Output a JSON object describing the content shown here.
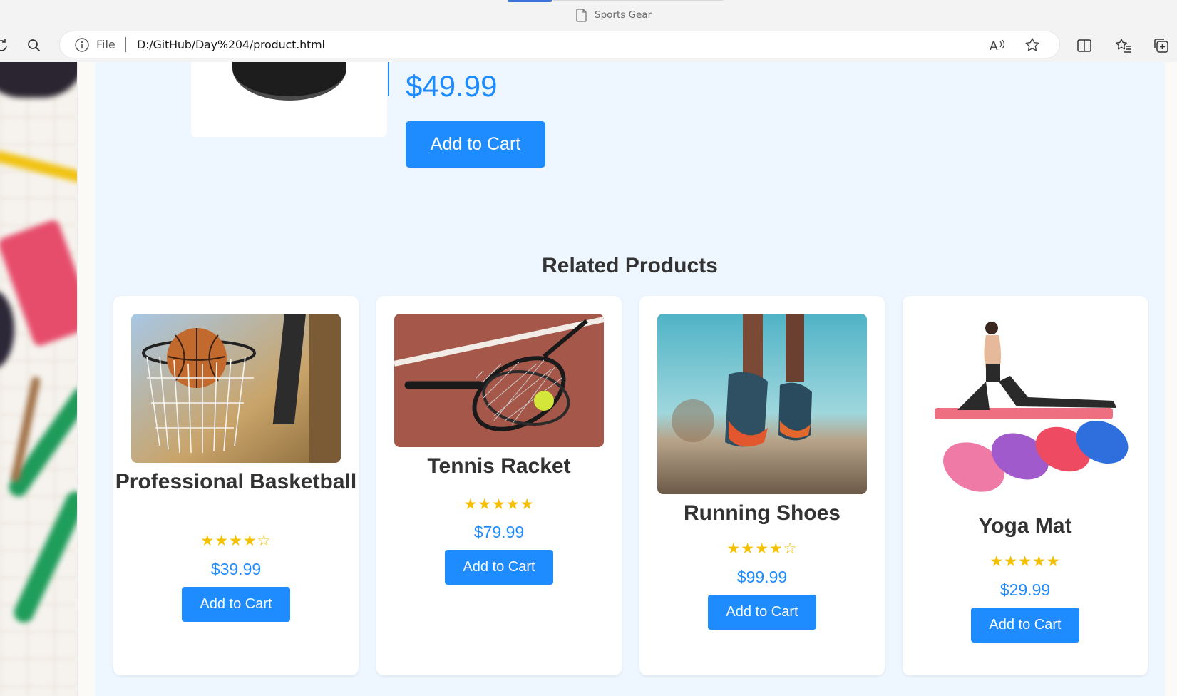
{
  "browser": {
    "tab_title": "Sports Gear",
    "address_prefix": "File",
    "url": "D:/GitHub/Day%204/product.html",
    "icons": [
      "refresh-icon",
      "search-icon",
      "info-icon",
      "read-aloud-icon",
      "favorite-star-icon",
      "split-screen-icon",
      "favorites-icon",
      "collections-icon",
      "document-icon"
    ]
  },
  "product": {
    "price": "$49.99",
    "add_to_cart": "Add to Cart"
  },
  "related": {
    "title": "Related Products",
    "items": [
      {
        "name": "Professional Basketball",
        "stars": "★★★★☆",
        "rating": 4,
        "price": "$39.99",
        "button": "Add to Cart",
        "image": "basketball-hoop-image"
      },
      {
        "name": "Tennis Racket",
        "stars": "★★★★★",
        "rating": 5,
        "price": "$79.99",
        "button": "Add to Cart",
        "image": "tennis-racket-image"
      },
      {
        "name": "Running Shoes",
        "stars": "★★★★☆",
        "rating": 4,
        "price": "$99.99",
        "button": "Add to Cart",
        "image": "running-shoes-image"
      },
      {
        "name": "Yoga Mat",
        "stars": "★★★★★",
        "rating": 5,
        "price": "$29.99",
        "button": "Add to Cart",
        "image": "yoga-mat-image"
      }
    ]
  },
  "colors": {
    "accent": "#1e8bff",
    "star": "#f5c000",
    "section_bg": "#eef6ff",
    "heading": "#333333"
  }
}
